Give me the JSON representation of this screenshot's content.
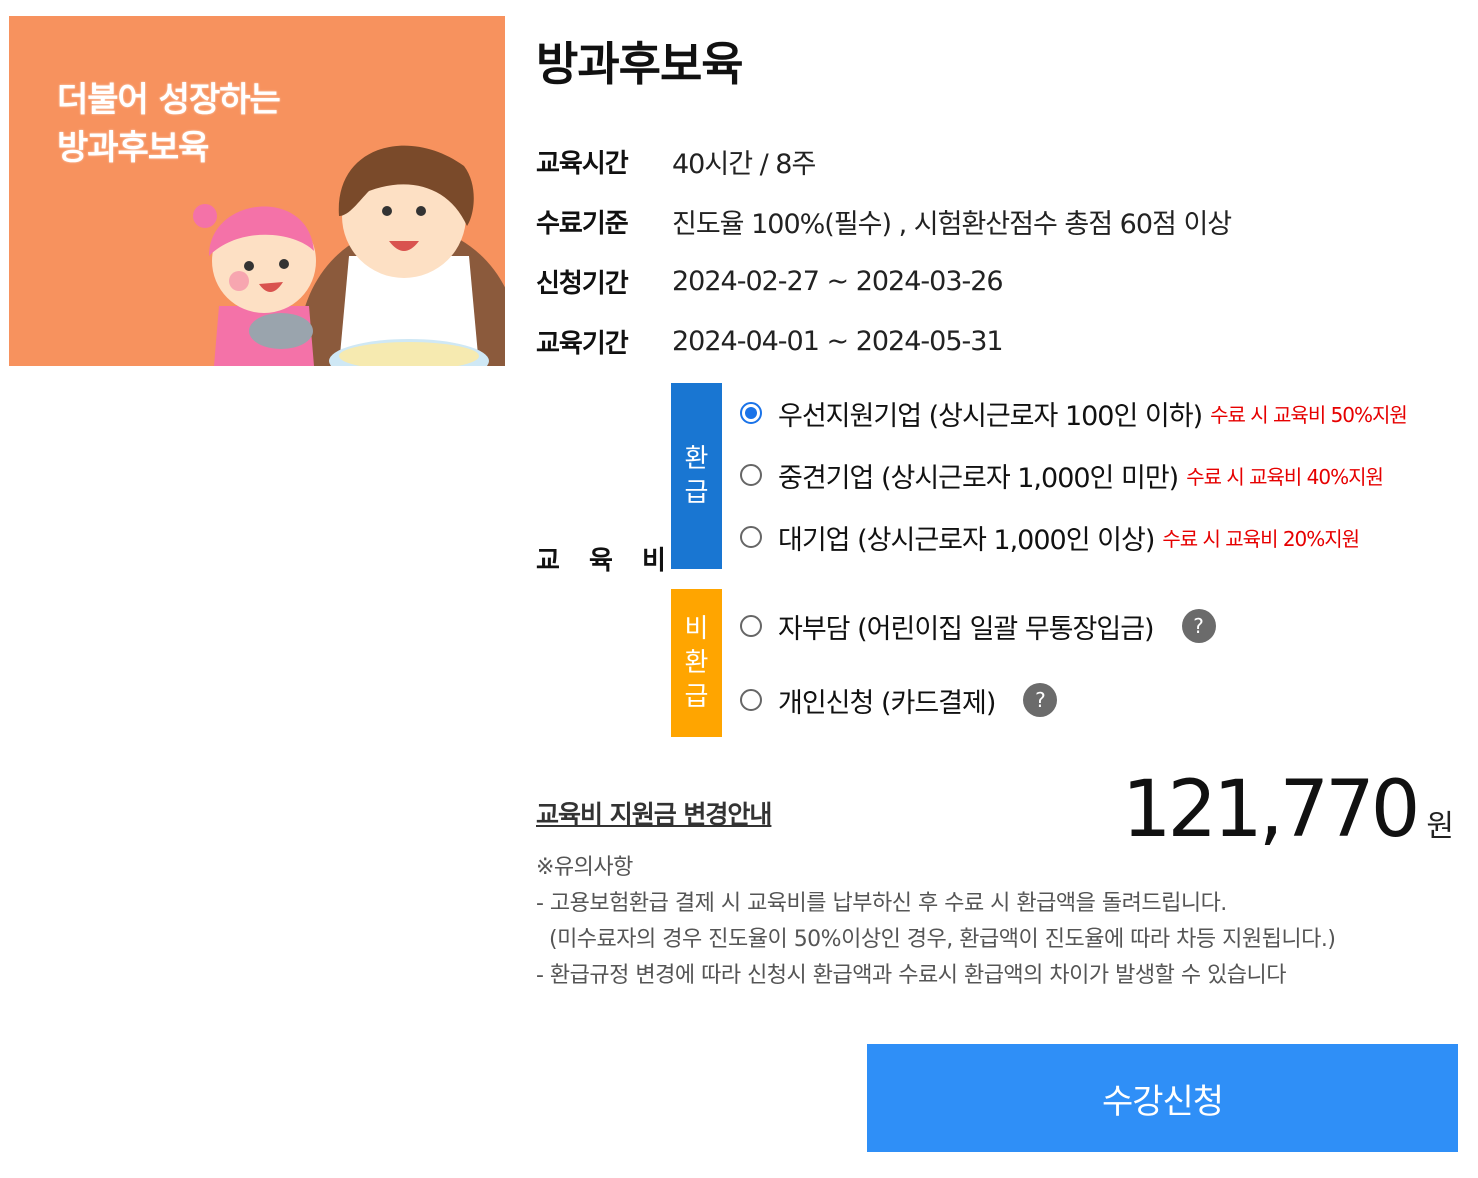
{
  "thumbnail": {
    "line1": "더불어 성장하는",
    "line2": "방과후보육",
    "background": "#f7925e"
  },
  "course": {
    "title": "방과후보육",
    "info": [
      {
        "label": "교육시간",
        "value": "40시간 / 8주"
      },
      {
        "label": "수료기준",
        "value": "진도율 100%(필수) , 시험환산점수 총점 60점 이상"
      },
      {
        "label": "신청기간",
        "value": "2024-02-27 ~ 2024-03-26"
      },
      {
        "label": "교육기간",
        "value": "2024-04-01 ~ 2024-05-31"
      }
    ]
  },
  "fee": {
    "label": "교 육 비",
    "refund_badge": "환급",
    "nonrefund_badge": "비환급",
    "refund_options": [
      {
        "label": "우선지원기업 (상시근로자 100인 이하)",
        "note": "수료 시 교육비 50%지원",
        "checked": true
      },
      {
        "label": "중견기업 (상시근로자 1,000인 미만)",
        "note": "수료 시 교육비 40%지원",
        "checked": false
      },
      {
        "label": "대기업 (상시근로자 1,000인 이상)",
        "note": "수료 시 교육비 20%지원",
        "checked": false
      }
    ],
    "nonrefund_options": [
      {
        "label": "자부담 (어린이집 일괄 무통장입금)",
        "help": "?",
        "checked": false
      },
      {
        "label": "개인신청 (카드결제)",
        "help": "?",
        "checked": false
      }
    ],
    "colors": {
      "refund": "#1976d2",
      "nonrefund": "#ffa500",
      "note": "#e60000"
    }
  },
  "notice_link": "교육비 지원금 변경안내",
  "price": {
    "value": "121,770",
    "unit": "원"
  },
  "caution": {
    "heading": "※유의사항",
    "lines": [
      "- 고용보험환급 결제 시 교육비를 납부하신 후 수료 시 환급액을 돌려드립니다.",
      "  (미수료자의 경우 진도율이 50%이상인 경우, 환급액이 진도율에 따라 차등 지원됩니다.)",
      "- 환급규정 변경에 따라 신청시 환급액과 수료시 환급액의 차이가 발생할 수 있습니다"
    ]
  },
  "apply_button": {
    "label": "수강신청",
    "color": "#2f8ff7"
  }
}
